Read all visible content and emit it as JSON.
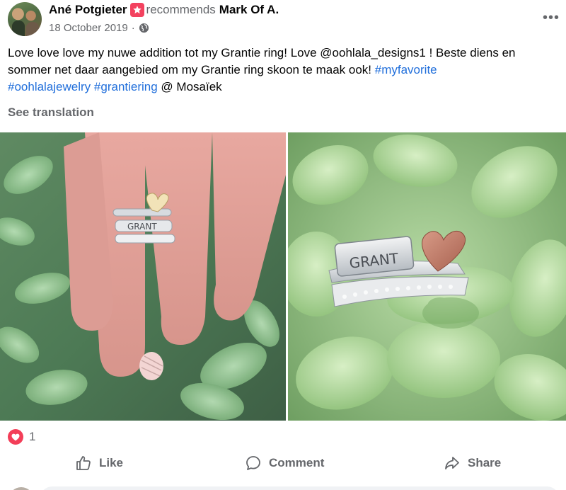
{
  "post": {
    "author": "Ané Potgieter",
    "action": "recommends",
    "page": "Mark Of A.",
    "date": "18 October 2019",
    "separator": "·",
    "privacy_icon": "globe-icon",
    "more_label": "•••",
    "text": {
      "part1": "Love love love my nuwe addition tot my Grantie ring! Love @oohlala_designs1 ! Beste diens en sommer net daar aangebied om my Grantie ring skoon te maak ook! ",
      "tag1": "#myfavorite",
      "tag2": "#oohlalajewelry",
      "tag3": "#grantiering",
      "part2": " @ Mosaïek"
    },
    "see_translation": "See translation",
    "photos": [
      {
        "alt": "hand-wearing-stacked-rings",
        "ring_text": "GRANT"
      },
      {
        "alt": "stacked-rings-on-succulent",
        "ring_text": "GRANT"
      }
    ]
  },
  "reactions": {
    "icon": "heart-icon",
    "count": "1",
    "color": "#f33e58"
  },
  "actions": {
    "like": "Like",
    "comment": "Comment",
    "share": "Share"
  },
  "colors": {
    "link": "#216fdb",
    "muted": "#65676b",
    "recommend_badge": "#f3425f"
  }
}
